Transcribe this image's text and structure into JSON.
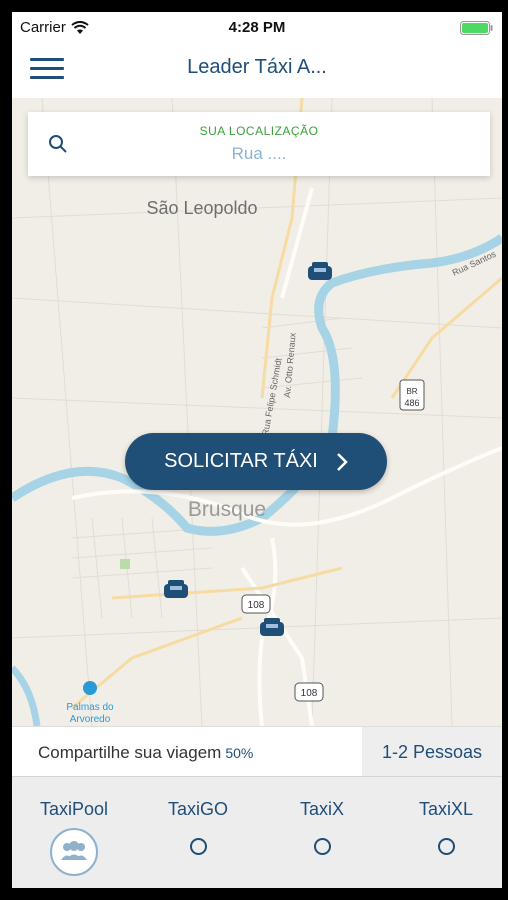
{
  "status": {
    "carrier": "Carrier",
    "time": "4:28 PM"
  },
  "nav": {
    "title": "Leader Táxi A..."
  },
  "search": {
    "label": "SUA LOCALIZAÇÃO",
    "value": "Rua ...."
  },
  "map": {
    "labels": [
      "São Leopoldo",
      "Brusque",
      "Rua Felipe Schmidt",
      "Av. Otto Renaux",
      "Rua Santos",
      "Palmas do",
      "Arvoredo"
    ],
    "road_shields": [
      "BR 486",
      "108",
      "108"
    ]
  },
  "request_button": {
    "label": "SOLICITAR TÁXI"
  },
  "share": {
    "text": "Compartilhe sua viagem",
    "discount": "50%",
    "people": "1-2 Pessoas"
  },
  "options": [
    {
      "label": "TaxiPool",
      "selected": true
    },
    {
      "label": "TaxiGO",
      "selected": false
    },
    {
      "label": "TaxiX",
      "selected": false
    },
    {
      "label": "TaxiXL",
      "selected": false
    }
  ],
  "colors": {
    "primary": "#1f4e76",
    "accent_green": "#3aa03a",
    "river": "#a6d4e6",
    "road": "#ffffff",
    "map_bg": "#f1eee7"
  }
}
